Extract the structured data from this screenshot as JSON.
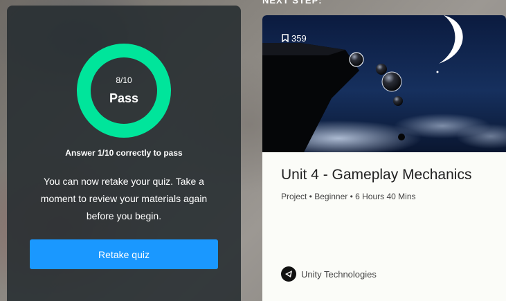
{
  "header": {
    "next_step_label": "NEXT STEP:"
  },
  "quiz": {
    "score": "8/10",
    "result": "Pass",
    "result_color": "#00e59b",
    "progress": 1.0,
    "requirement": "Answer 1/10 correctly to pass",
    "message": "You can now retake your quiz. Take a moment to review your materials again before you begin.",
    "retake_label": "Retake quiz",
    "button_color": "#1a98ff"
  },
  "card": {
    "bookmark_icon": "bookmark-icon",
    "bookmark_count": "359",
    "title": "Unit 4 - Gameplay Mechanics",
    "meta": "Project • Beginner • 6 Hours  40 Mins",
    "author_icon": "unity-logo-icon",
    "author": "Unity Technologies"
  }
}
